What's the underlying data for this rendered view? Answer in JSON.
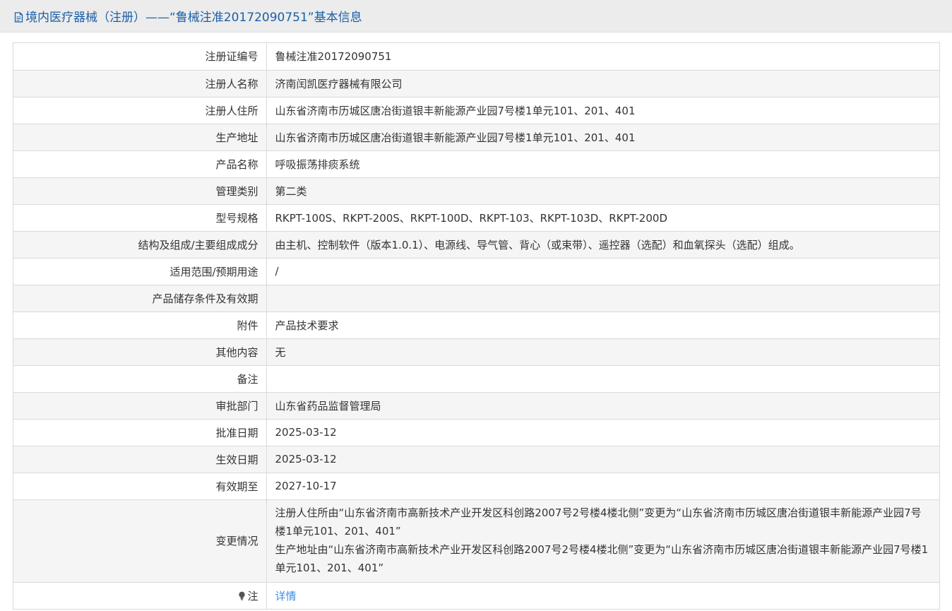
{
  "header": {
    "title": "境内医疗器械（注册）——“鲁械注准20172090751”基本信息"
  },
  "rows": [
    {
      "label": "注册证编号",
      "value": "鲁械注准20172090751"
    },
    {
      "label": "注册人名称",
      "value": "济南闰凯医疗器械有限公司"
    },
    {
      "label": "注册人住所",
      "value": "山东省济南市历城区唐冶街道银丰新能源产业园7号楼1单元101、201、401"
    },
    {
      "label": "生产地址",
      "value": "山东省济南市历城区唐冶街道银丰新能源产业园7号楼1单元101、201、401"
    },
    {
      "label": "产品名称",
      "value": "呼吸振荡排痰系统"
    },
    {
      "label": "管理类别",
      "value": "第二类"
    },
    {
      "label": "型号规格",
      "value": "RKPT-100S、RKPT-200S、RKPT-100D、RKPT-103、RKPT-103D、RKPT-200D"
    },
    {
      "label": "结构及组成/主要组成成分",
      "value": "由主机、控制软件（版本1.0.1）、电源线、导气管、背心（或束带）、遥控器（选配）和血氧探头（选配）组成。"
    },
    {
      "label": "适用范围/预期用途",
      "value": "/"
    },
    {
      "label": "产品储存条件及有效期",
      "value": ""
    },
    {
      "label": "附件",
      "value": "产品技术要求"
    },
    {
      "label": "其他内容",
      "value": "无"
    },
    {
      "label": "备注",
      "value": ""
    },
    {
      "label": "审批部门",
      "value": "山东省药品监督管理局"
    },
    {
      "label": "批准日期",
      "value": "2025-03-12"
    },
    {
      "label": "生效日期",
      "value": "2025-03-12"
    },
    {
      "label": "有效期至",
      "value": "2027-10-17"
    }
  ],
  "changes": {
    "label": "变更情况",
    "line1": "注册人住所由“山东省济南市高新技术产业开发区科创路2007号2号楼4楼北侧”变更为“山东省济南市历城区唐冶街道银丰新能源产业园7号楼1单元101、201、401”",
    "line2": "生产地址由“山东省济南市高新技术产业开发区科创路2007号2号楼4楼北侧”变更为“山东省济南市历城区唐冶街道银丰新能源产业园7号楼1单元101、201、401”"
  },
  "note": {
    "label": "注",
    "link": "详情"
  },
  "icons": {
    "title_icon": "document-icon",
    "note_icon": "lightbulb-icon"
  },
  "colors": {
    "title": "#1a5fa8",
    "link": "#3a8ee6"
  }
}
